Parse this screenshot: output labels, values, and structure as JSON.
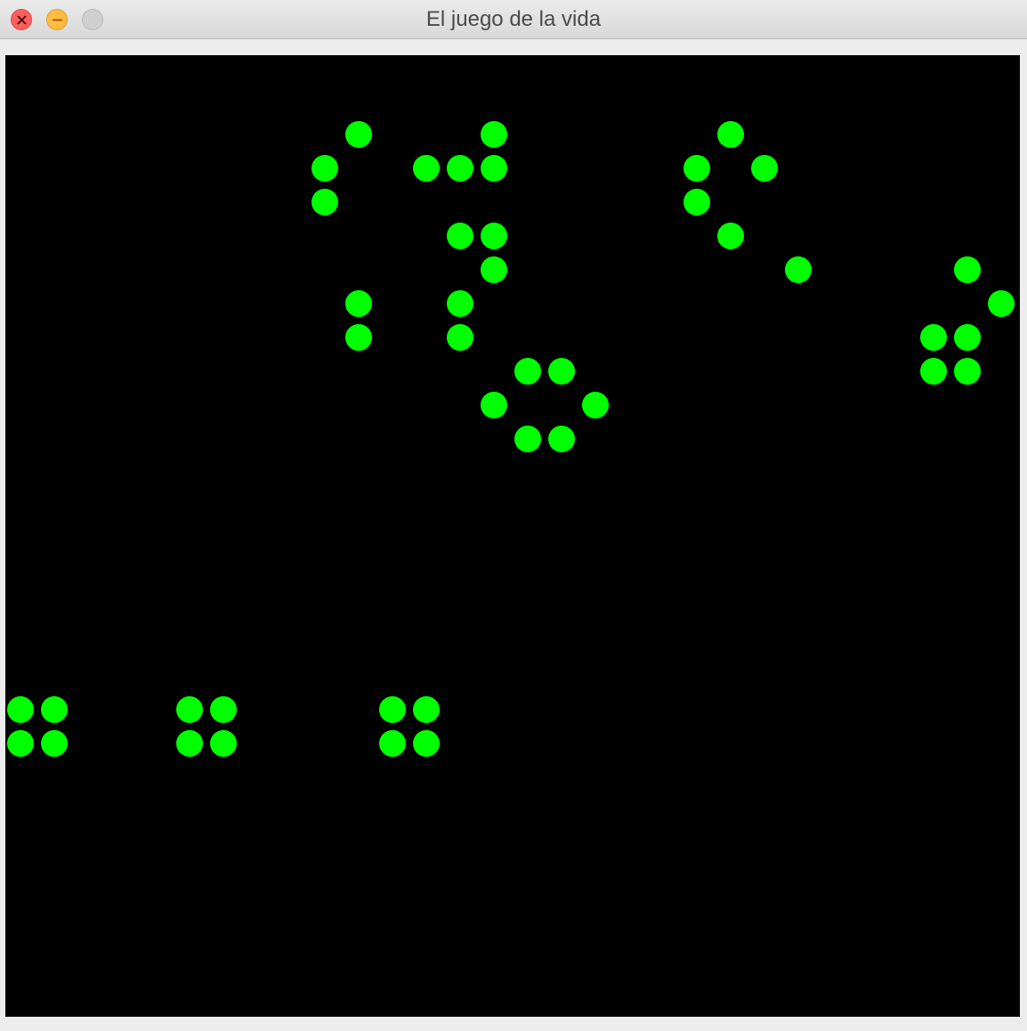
{
  "window": {
    "title": "El juego de la vida"
  },
  "colors": {
    "background": "#000000",
    "cell": "#00ff00",
    "close": "#fc605c",
    "minimize": "#fdbc40",
    "zoom": "#cfcfcf"
  },
  "grid": {
    "cell_pitch_label": "38px",
    "alive_cells": [
      [
        10,
        2
      ],
      [
        14,
        2
      ],
      [
        21,
        2
      ],
      [
        9,
        3
      ],
      [
        12,
        3
      ],
      [
        13,
        3
      ],
      [
        14,
        3
      ],
      [
        20,
        3
      ],
      [
        22,
        3
      ],
      [
        9,
        4
      ],
      [
        20,
        4
      ],
      [
        13,
        5
      ],
      [
        14,
        5
      ],
      [
        21,
        5
      ],
      [
        14,
        6
      ],
      [
        23,
        6
      ],
      [
        28,
        6
      ],
      [
        10,
        7
      ],
      [
        13,
        7
      ],
      [
        29,
        7
      ],
      [
        10,
        8
      ],
      [
        13,
        8
      ],
      [
        27,
        8
      ],
      [
        28,
        8
      ],
      [
        15,
        9
      ],
      [
        16,
        9
      ],
      [
        27,
        9
      ],
      [
        28,
        9
      ],
      [
        14,
        10
      ],
      [
        17,
        10
      ],
      [
        15,
        11
      ],
      [
        16,
        11
      ],
      [
        0,
        19
      ],
      [
        1,
        19
      ],
      [
        5,
        19
      ],
      [
        6,
        19
      ],
      [
        11,
        19
      ],
      [
        12,
        19
      ],
      [
        0,
        20
      ],
      [
        1,
        20
      ],
      [
        5,
        20
      ],
      [
        6,
        20
      ],
      [
        11,
        20
      ],
      [
        12,
        20
      ]
    ]
  }
}
